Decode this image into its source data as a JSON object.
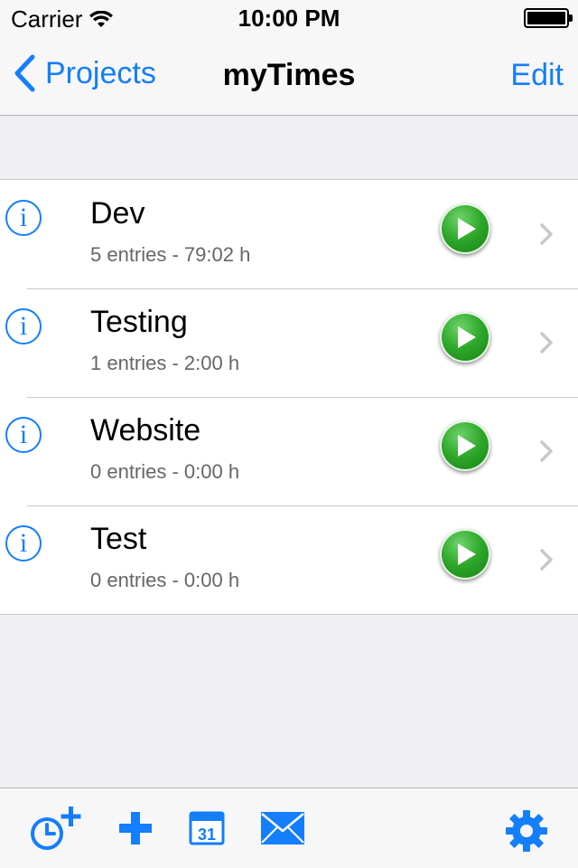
{
  "status_bar": {
    "carrier": "Carrier",
    "time": "10:00 PM"
  },
  "nav": {
    "back_label": "Projects",
    "title": "myTimes",
    "edit_label": "Edit"
  },
  "projects": [
    {
      "name": "Dev",
      "summary": "5 entries - 79:02 h"
    },
    {
      "name": "Testing",
      "summary": "1 entries - 2:00 h"
    },
    {
      "name": "Website",
      "summary": "0 entries - 0:00 h"
    },
    {
      "name": "Test",
      "summary": "0 entries - 0:00 h"
    }
  ],
  "icons": {
    "info": "i",
    "calendar_day": "31"
  },
  "colors": {
    "accent": "#147efb",
    "play_green": "#2fa82b"
  }
}
